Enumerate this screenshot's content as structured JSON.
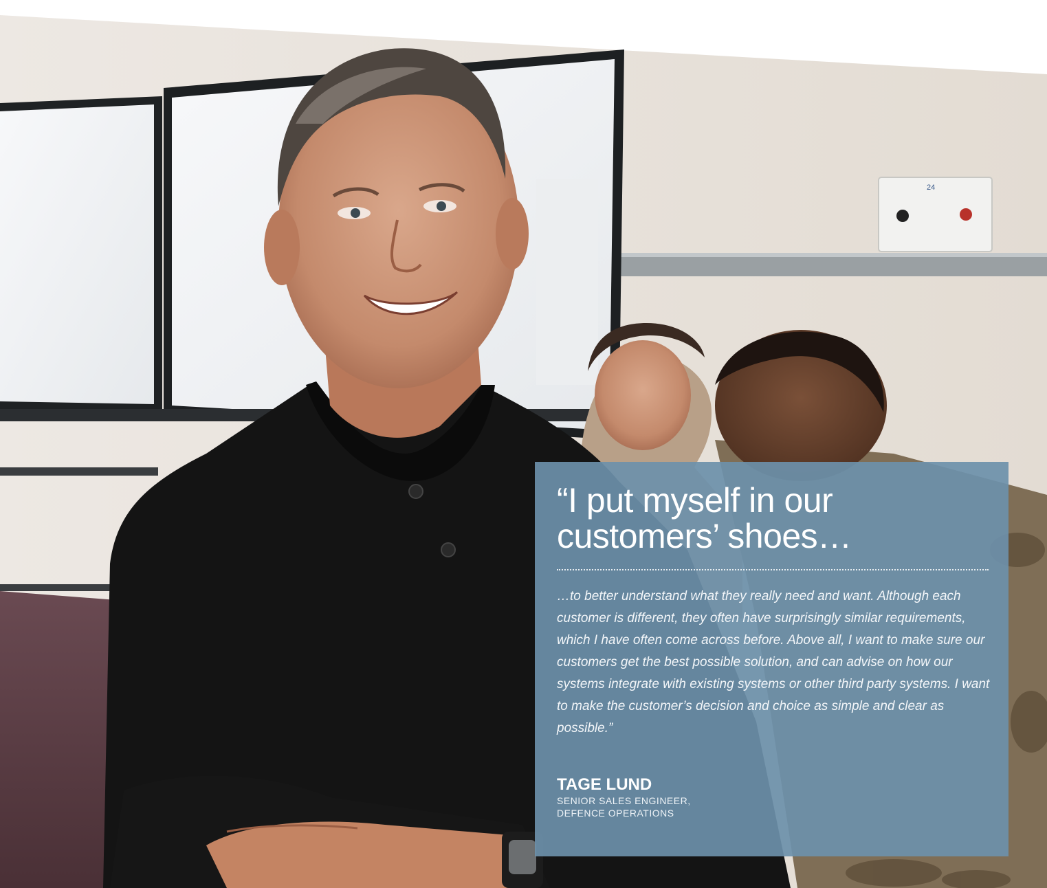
{
  "quote": {
    "headline": "“I put myself in our customers’ shoes…",
    "body": "…to better understand what they really need and want. Although each customer is different, they often have surprisingly similar requirements, which I have often come across before. Above all, I want to make sure our customers get the best possible solution, and can advise on how our systems integrate with existing systems or other third party systems. I want to make the customer’s decision and choice as simple and clear as possible.”"
  },
  "person": {
    "name": "TAGE LUND",
    "role_line1": "SENIOR SALES ENGINEER,",
    "role_line2": "DEFENCE OPERATIONS"
  },
  "colors": {
    "quote_box": "#6c90aa",
    "text": "#ffffff"
  }
}
